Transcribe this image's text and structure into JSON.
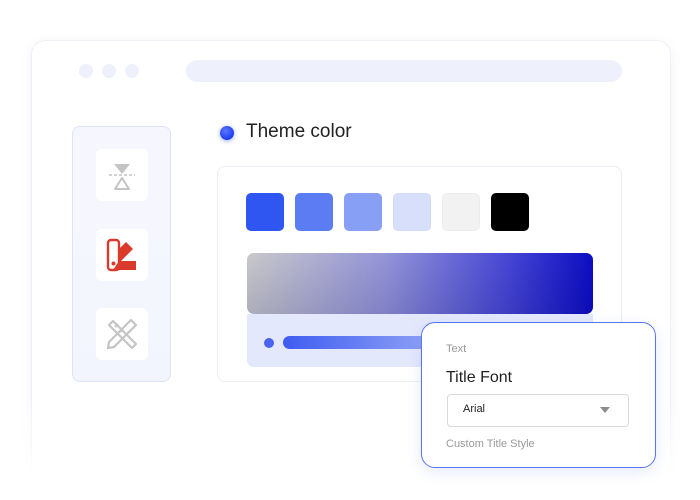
{
  "window": {
    "traffic_dots": [
      "dot",
      "dot",
      "dot"
    ]
  },
  "toolbar": {
    "tools": [
      {
        "icon": "text-baseline-icon",
        "color": "#c8c8c8"
      },
      {
        "icon": "paint-palette-icon",
        "color": "#d93a2b"
      },
      {
        "icon": "design-tools-icon",
        "color": "#c8c8c8"
      }
    ]
  },
  "theme": {
    "label": "Theme color",
    "swatches": [
      "#2f56f1",
      "#5b7cf3",
      "#87a0f6",
      "#d7dffb",
      "#f2f2f2",
      "#000000"
    ],
    "gradient_end_color": "#0000c0",
    "slider_colors": [
      "#3f5cf1",
      "#8fa2f5"
    ]
  },
  "popup": {
    "section_label": "Text",
    "title": "Title Font",
    "font_select_value": "Arial",
    "footer_label": "Custom Title Style",
    "border_color": "#5a74ee"
  }
}
